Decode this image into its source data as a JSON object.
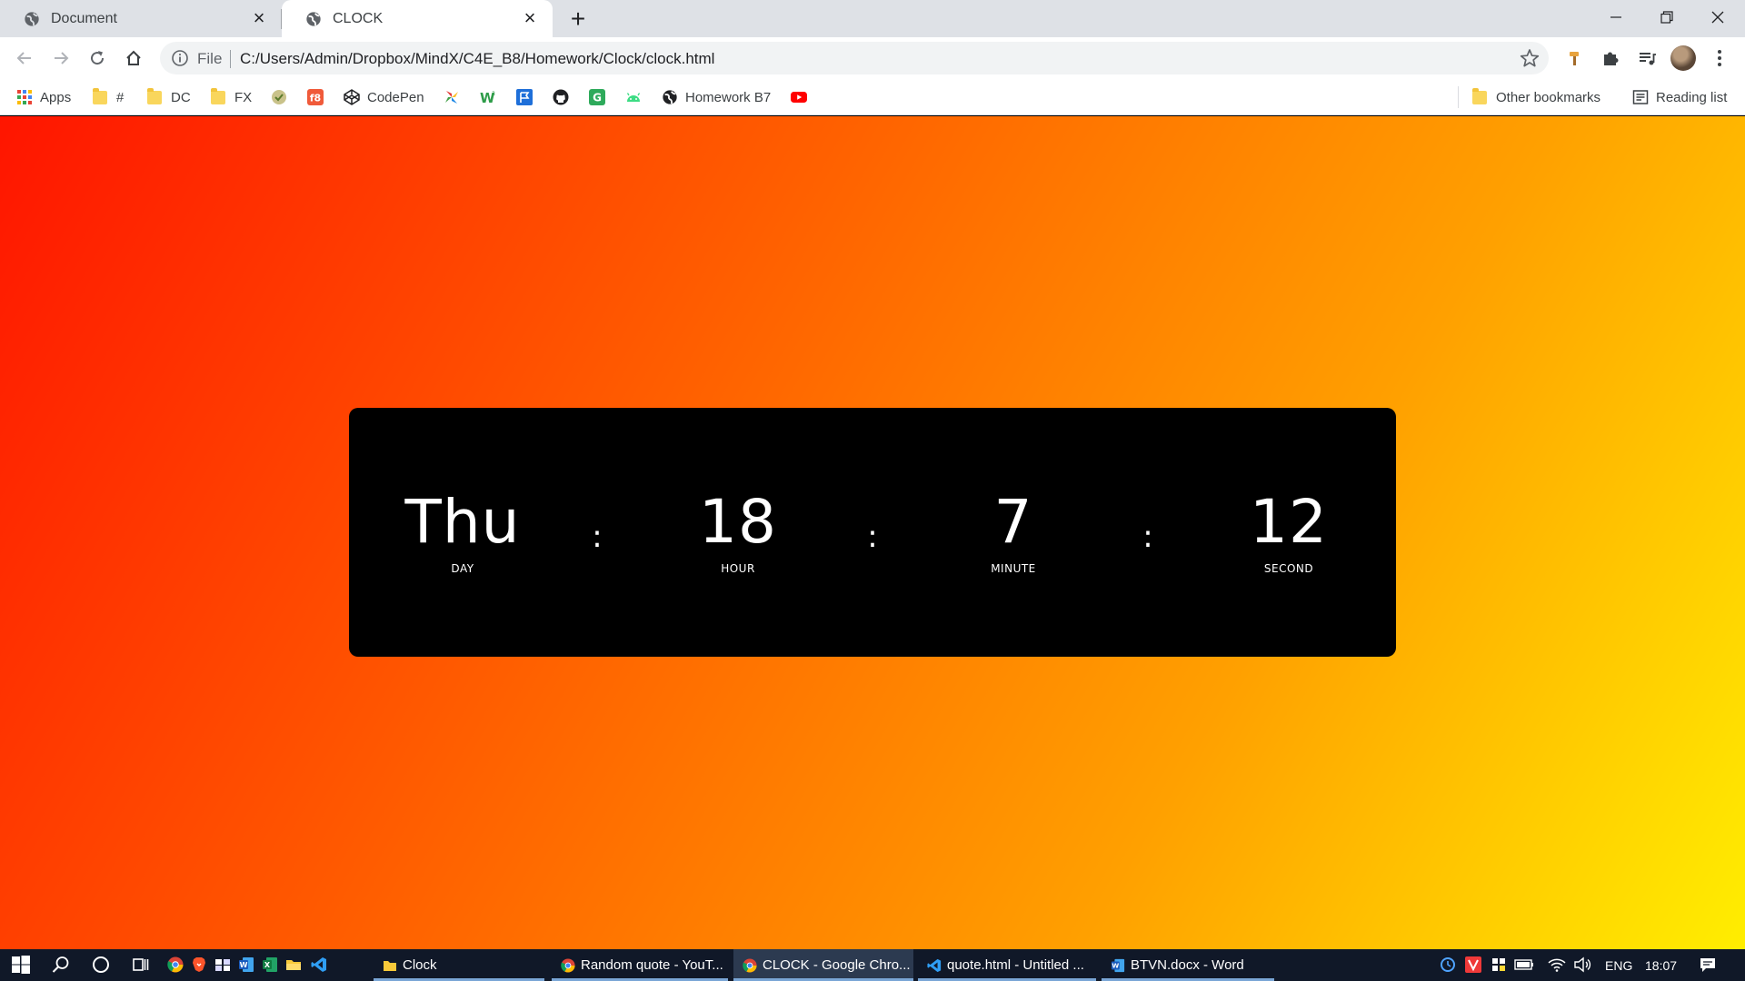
{
  "browser": {
    "tabs": [
      {
        "title": "Document",
        "active": false
      },
      {
        "title": "CLOCK",
        "active": true
      }
    ],
    "address": {
      "scheme_label": "File",
      "url": "C:/Users/Admin/Dropbox/MindX/C4E_B8/Homework/Clock/clock.html"
    },
    "bookmarks": {
      "apps_label": "Apps",
      "hash_label": "#",
      "dc_label": "DC",
      "fx_label": "FX",
      "codepen_label": "CodePen",
      "homework_label": "Homework B7",
      "other_label": "Other bookmarks",
      "reading_label": "Reading list"
    }
  },
  "clock": {
    "day": {
      "value": "Thu",
      "label": "DAY"
    },
    "hour": {
      "value": "18",
      "label": "HOUR"
    },
    "minute": {
      "value": "7",
      "label": "MINUTE"
    },
    "second": {
      "value": "12",
      "label": "SECOND"
    },
    "separator": ":"
  },
  "taskbar": {
    "apps": [
      {
        "title": "Clock"
      },
      {
        "title": "Random quote - YouT..."
      },
      {
        "title": "CLOCK - Google Chro..."
      },
      {
        "title": "quote.html - Untitled ..."
      },
      {
        "title": "BTVN.docx - Word"
      }
    ],
    "language": "ENG",
    "time": "18:07"
  },
  "colors": {
    "gradient_start": "#ff1500",
    "gradient_end": "#ffee00",
    "clock_background": "#000000",
    "clock_text": "#ffffff"
  }
}
